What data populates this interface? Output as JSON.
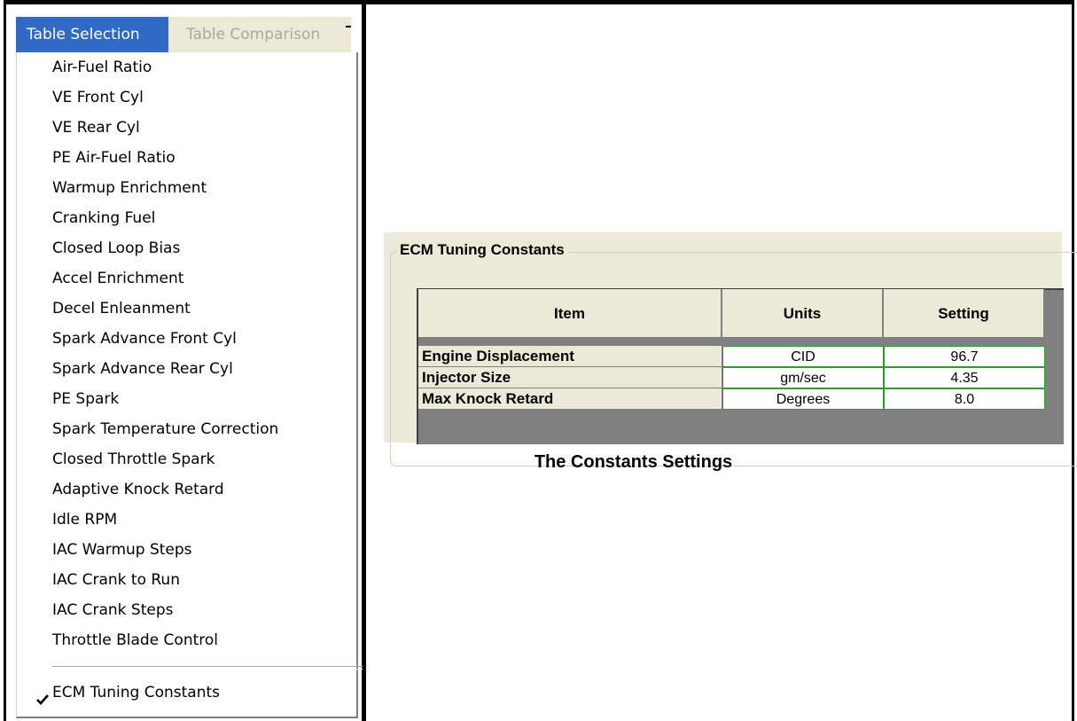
{
  "menu": {
    "titles": [
      "Table Selection",
      "Table Comparison"
    ],
    "items": [
      "Air-Fuel Ratio",
      "VE Front Cyl",
      "VE Rear Cyl",
      "PE Air-Fuel Ratio",
      "Warmup Enrichment",
      "Cranking Fuel",
      "Closed Loop Bias",
      "Accel Enrichment",
      "Decel Enleanment",
      "Spark Advance Front Cyl",
      "Spark Advance Rear Cyl",
      "PE Spark",
      "Spark Temperature Correction",
      "Closed Throttle Spark",
      "Adaptive Knock Retard",
      "Idle RPM",
      "IAC Warmup Steps",
      "IAC Crank to Run",
      "IAC Crank Steps",
      "Throttle Blade Control"
    ],
    "checked_item": "ECM Tuning Constants"
  },
  "panel": {
    "group_title": "ECM Tuning Constants",
    "headers": [
      "Item",
      "Units",
      "Setting"
    ],
    "rows": [
      {
        "item": "Engine Displacement",
        "units": "CID",
        "setting": "96.7"
      },
      {
        "item": "Injector Size",
        "units": "gm/sec",
        "setting": "4.35"
      },
      {
        "item": "Max Knock Retard",
        "units": "Degrees",
        "setting": "8.0"
      }
    ]
  },
  "caption": "The Constants Settings",
  "colors": {
    "menu_highlight": "#316ac5",
    "panel_bg": "#ece9d8",
    "cell_border": "#2e9a2e"
  }
}
